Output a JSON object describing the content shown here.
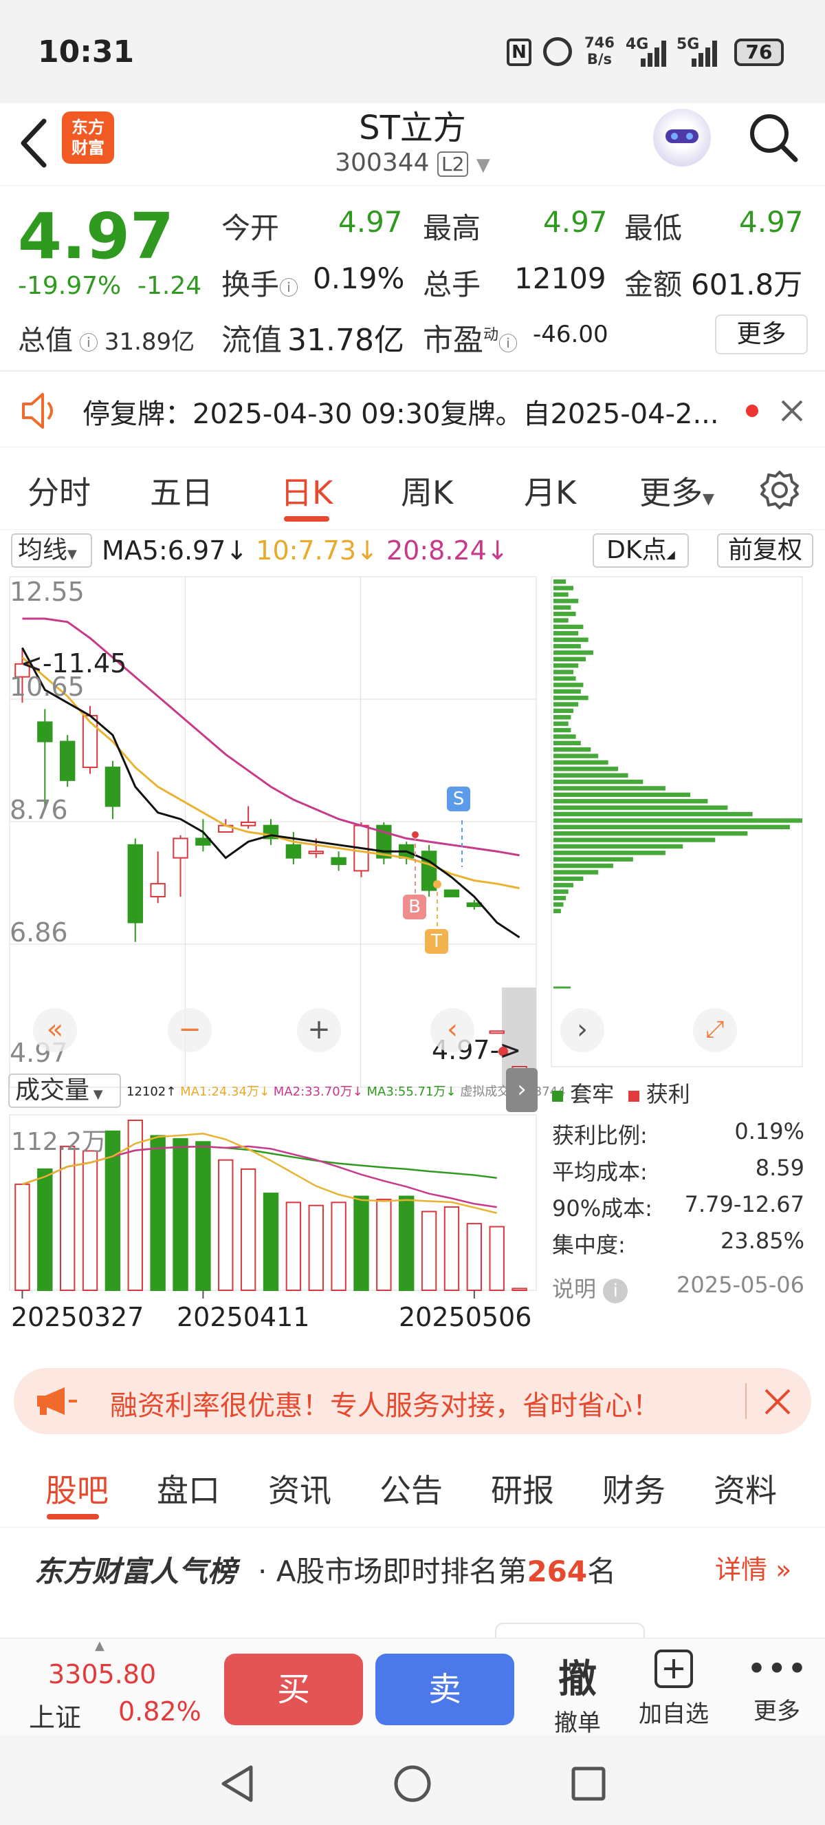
{
  "status": {
    "time": "10:31",
    "speed_top": "746",
    "speed_bottom": "B/s",
    "net1": "4G",
    "net2": "5G",
    "battery": "76"
  },
  "header": {
    "logo_line1": "东方",
    "logo_line2": "财富",
    "title": "ST立方",
    "code": "300344",
    "level": "L2"
  },
  "quote": {
    "price": "4.97",
    "pct": "-19.97%",
    "chg": "-1.24",
    "open_label": "今开",
    "open": "4.97",
    "high_label": "最高",
    "high": "4.97",
    "low_label": "最低",
    "low": "4.97",
    "turnover_label": "换手",
    "turnover": "0.19%",
    "volume_label": "总手",
    "volume": "12109",
    "amount_label": "金额",
    "amount": "601.8万",
    "mktcap_label": "总值",
    "mktcap": "31.89亿",
    "float_label": "流值",
    "float": "31.78亿",
    "pe_label": "市盈",
    "pe_sup": "动",
    "pe": "-46.00",
    "more": "更多"
  },
  "notice": {
    "text": "停复牌：2025-04-30 09:30复牌。自2025-04-2..."
  },
  "ktabs": [
    "分时",
    "五日",
    "日K",
    "周K",
    "月K",
    "更多"
  ],
  "ma": {
    "label": "均线",
    "ma5": "MA5:6.97",
    "ma10": "10:7.73",
    "ma20": "20:8.24",
    "dk": "DK点",
    "fq": "前复权"
  },
  "price_axis": [
    "12.55",
    "10.65",
    "8.76",
    "6.86",
    "4.97"
  ],
  "annot": {
    "max": "<-11.45",
    "last": "4.97->",
    "s": "S",
    "b": "B",
    "t": "T"
  },
  "vol": {
    "label": "成交量",
    "legend_vol": "12102↑",
    "legend_ma1": "MA1:24.34万↓",
    "legend_ma2": "MA2:33.70万↓",
    "legend_ma3": "MA3:55.71万↓",
    "legend_virtual": "虚拟成交量:13744",
    "max": "112.2万"
  },
  "dates": [
    "20250327",
    "20250411",
    "20250506"
  ],
  "chip": {
    "legend_trap": "套牢",
    "legend_profit": "获利",
    "profit_ratio_label": "获利比例:",
    "profit_ratio": "0.19%",
    "avg_cost_label": "平均成本:",
    "avg_cost": "8.59",
    "cost90_label": "90%成本:",
    "cost90": "7.79-12.67",
    "concentration_label": "集中度:",
    "concentration": "23.85%",
    "note": "说明",
    "date": "2025-05-06"
  },
  "ad": {
    "text": "融资利率很优惠！专人服务对接，省时省心！"
  },
  "subtabs": [
    "股吧",
    "盘口",
    "资讯",
    "公告",
    "研报",
    "财务",
    "资料"
  ],
  "rank": {
    "brand": "东方财富人气榜",
    "text_prefix": "· A股市场即时排名第",
    "rank": "264",
    "text_suffix": "名",
    "detail": "详情"
  },
  "bottom": {
    "index_value": "3305.80",
    "index_name": "上证",
    "index_pct": "0.82%",
    "buy": "买",
    "sell": "卖",
    "cancel_icon": "撤",
    "cancel": "撤单",
    "add": "加自选",
    "more": "更多"
  },
  "chart_data": {
    "type": "candlestick",
    "title": "",
    "dates_visible": [
      "20250327",
      "20250411",
      "20250506"
    ],
    "ylim": [
      4.97,
      12.55
    ],
    "candles": [
      [
        11.0,
        11.2,
        11.45,
        10.6
      ],
      [
        10.3,
        10.0,
        10.5,
        9.0
      ],
      [
        10.0,
        9.4,
        10.1,
        9.3
      ],
      [
        9.6,
        10.4,
        10.55,
        9.5
      ],
      [
        9.6,
        9.0,
        9.7,
        8.8
      ],
      [
        8.4,
        7.2,
        8.5,
        6.9
      ],
      [
        7.6,
        7.8,
        8.3,
        7.5
      ],
      [
        8.2,
        8.5,
        8.55,
        7.6
      ],
      [
        8.5,
        8.4,
        8.8,
        8.3
      ],
      [
        8.6,
        8.7,
        8.8,
        8.6
      ],
      [
        8.7,
        8.75,
        9.0,
        8.65
      ],
      [
        8.7,
        8.5,
        8.8,
        8.4
      ],
      [
        8.4,
        8.2,
        8.6,
        8.1
      ],
      [
        8.3,
        8.3,
        8.5,
        8.2
      ],
      [
        8.2,
        8.1,
        8.3,
        8.0
      ],
      [
        8.0,
        8.7,
        8.75,
        7.9
      ],
      [
        8.7,
        8.2,
        8.75,
        8.1
      ],
      [
        8.4,
        8.2,
        8.45,
        8.1
      ],
      [
        8.3,
        7.7,
        8.4,
        7.6
      ],
      [
        7.7,
        7.6,
        7.7,
        7.6
      ],
      [
        7.5,
        7.45,
        7.55,
        7.4
      ],
      [
        5.52,
        5.52,
        5.52,
        5.52
      ],
      [
        4.97,
        4.97,
        4.97,
        4.97
      ]
    ],
    "ma5": [
      11.45,
      10.8,
      10.6,
      10.4,
      10.1,
      9.3,
      8.9,
      8.8,
      8.6,
      8.2,
      8.45,
      8.55,
      8.5,
      8.45,
      8.4,
      8.35,
      8.3,
      8.3,
      8.15,
      7.9,
      7.6,
      7.2,
      6.97
    ],
    "ma10": [
      11.3,
      11.0,
      10.7,
      10.3,
      10.0,
      9.6,
      9.3,
      9.1,
      8.9,
      8.7,
      8.6,
      8.55,
      8.45,
      8.4,
      8.35,
      8.3,
      8.25,
      8.2,
      8.1,
      7.95,
      7.85,
      7.8,
      7.73
    ],
    "ma20": [
      11.9,
      11.9,
      11.85,
      11.6,
      11.3,
      11.0,
      10.7,
      10.4,
      10.1,
      9.8,
      9.55,
      9.3,
      9.1,
      8.95,
      8.8,
      8.7,
      8.6,
      8.5,
      8.45,
      8.4,
      8.35,
      8.3,
      8.24
    ],
    "volumes": [
      70,
      80,
      95,
      92,
      105,
      112.2,
      102,
      100,
      98,
      86,
      80,
      64,
      58,
      56,
      58,
      62,
      60,
      62,
      52,
      55,
      44,
      42,
      1.2
    ],
    "vol_up": [
      true,
      false,
      true,
      true,
      false,
      true,
      false,
      false,
      false,
      true,
      true,
      false,
      true,
      true,
      true,
      false,
      true,
      false,
      true,
      true,
      true,
      true,
      true
    ]
  }
}
